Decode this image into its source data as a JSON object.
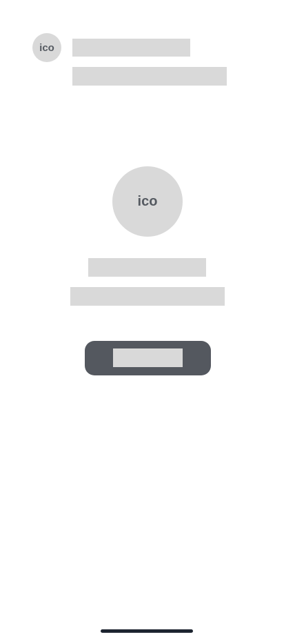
{
  "header": {
    "avatar_icon": "ico",
    "title_placeholder": "",
    "subtitle_placeholder": ""
  },
  "empty_state": {
    "icon_label": "ico",
    "title_placeholder": "",
    "message_placeholder": "",
    "action_label": ""
  },
  "colors": {
    "background": "#ffffff",
    "placeholder": "#d9d9d9",
    "button": "#54585f",
    "icon_text": "#555a61",
    "home_indicator": "#1d2430"
  }
}
